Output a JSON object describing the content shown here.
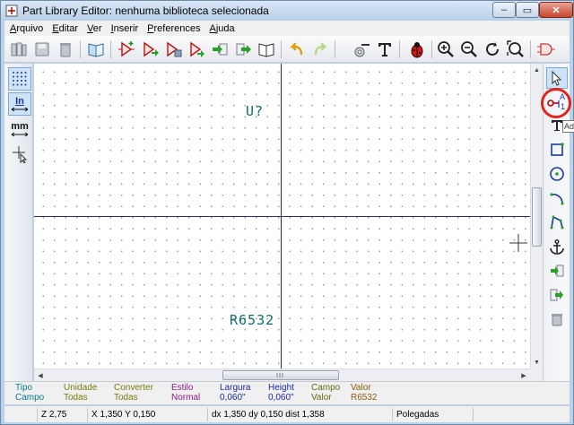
{
  "window": {
    "title": "Part Library Editor: nenhuma biblioteca selecionada",
    "minimize_glyph": "–",
    "maximize_glyph": "▭",
    "close_glyph": "✕"
  },
  "menu": {
    "items": [
      {
        "underline": "A",
        "rest": "rquivo"
      },
      {
        "underline": "E",
        "rest": "ditar"
      },
      {
        "underline": "V",
        "rest": "er"
      },
      {
        "underline": "I",
        "rest": "nserir"
      },
      {
        "underline": "P",
        "rest": "references"
      },
      {
        "underline": "A",
        "rest": "juda"
      }
    ]
  },
  "left_toolbar": {
    "units_inch": "In",
    "units_mm": "mm"
  },
  "canvas": {
    "reference": "U?",
    "value": "R6532"
  },
  "tooltip": {
    "text": "Ad"
  },
  "right_toolbar": {
    "pin_tool_letter": "A",
    "pin_tool_number": "1"
  },
  "message_panel": {
    "columns": [
      {
        "label": "Tipo",
        "value": "Campo",
        "label_color": "#0a7a8a",
        "value_color": "#0a7a8a"
      },
      {
        "label": "Unidade",
        "value": "Todas",
        "label_color": "#7a7a10",
        "value_color": "#7a7a10"
      },
      {
        "label": "Converter",
        "value": "Todas",
        "label_color": "#7a7a10",
        "value_color": "#7a7a10"
      },
      {
        "label": "Estilo",
        "value": "Normal",
        "label_color": "#8a1a8a",
        "value_color": "#8a1a8a"
      },
      {
        "label": "Largura",
        "value": "0,060\"",
        "label_color": "#1a2aa0",
        "value_color": "#1a2aa0"
      },
      {
        "label": "Height",
        "value": "0,060\"",
        "label_color": "#1a2aa0",
        "value_color": "#1a2aa0"
      },
      {
        "label": "Campo",
        "value": "Valor",
        "label_color": "#6a6a10",
        "value_color": "#6a6a10"
      },
      {
        "label": "Valor",
        "value": "R6532",
        "label_color": "#8a5a10",
        "value_color": "#8a5a10"
      }
    ]
  },
  "status": {
    "zoom": "Z 2,75",
    "xy": "X 1,350  Y 0,150",
    "delta": "dx 1,350  dy 0,150  dist 1,358",
    "units": "Polegadas"
  }
}
